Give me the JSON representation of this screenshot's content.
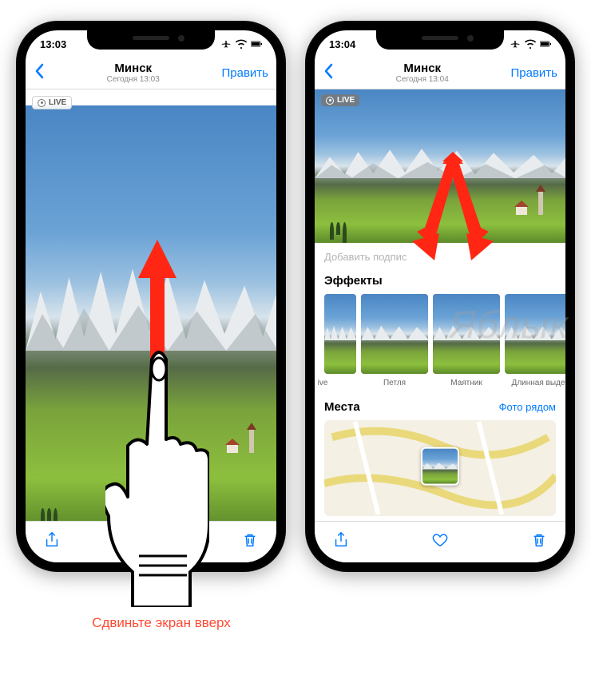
{
  "status": {
    "time_left": "13:03",
    "time_right": "13:04"
  },
  "nav": {
    "title": "Минск",
    "subtitle_left": "Сегодня 13:03",
    "subtitle_right": "Сегодня 13:04",
    "edit": "Править"
  },
  "live_badge": "LIVE",
  "left": {
    "hint": "Сдвиньте экран вверх"
  },
  "right": {
    "caption_placeholder": "Добавить подпис",
    "effects_title": "Эффекты",
    "effects": [
      {
        "label": "ive",
        "highlight": false
      },
      {
        "label": "Петля",
        "highlight": true
      },
      {
        "label": "Маятник",
        "highlight": true
      },
      {
        "label": "Длинная выде",
        "highlight": false
      }
    ],
    "places_title": "Места",
    "places_link": "Фото рядом"
  },
  "watermark": "Яблык",
  "colors": {
    "ios_blue": "#007aff",
    "annotation_red": "#ff2713"
  }
}
